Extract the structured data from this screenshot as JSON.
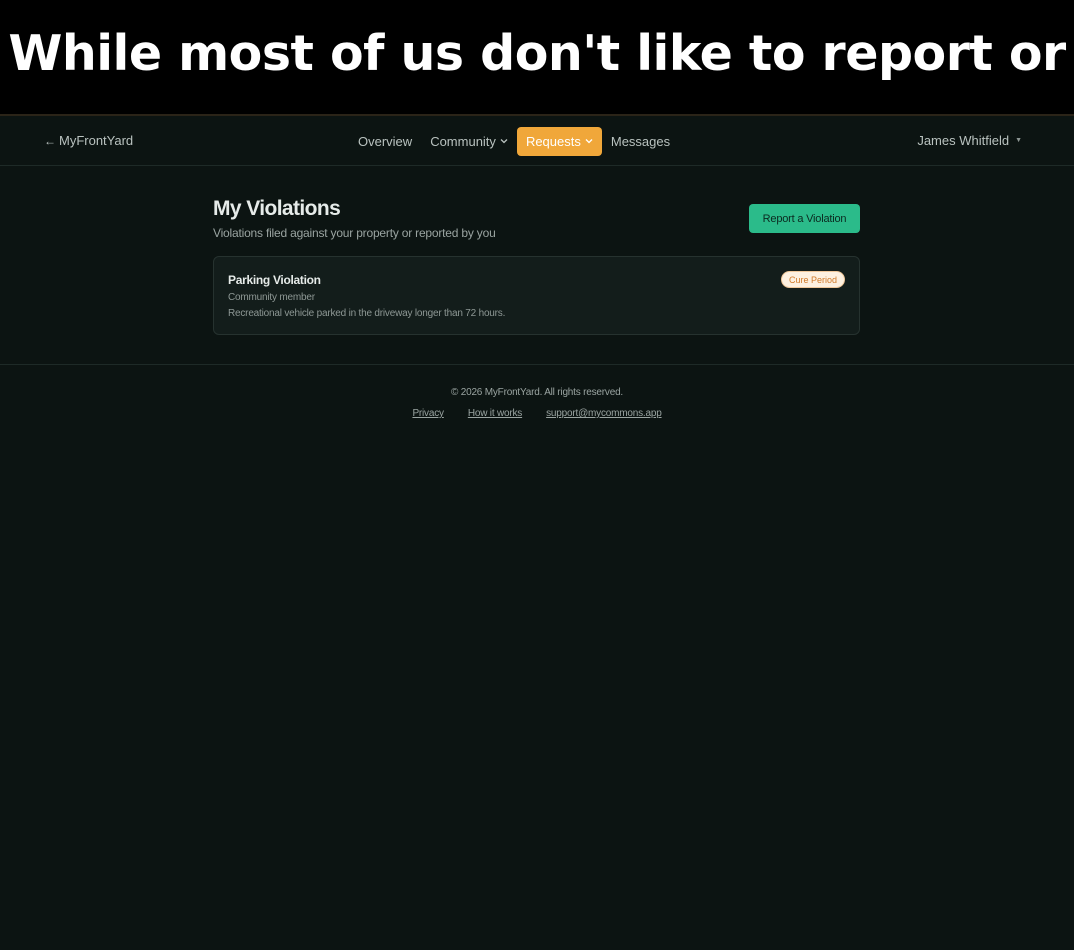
{
  "caption": "While most of us don't like to report or",
  "nav": {
    "back_label": "MyFrontYard",
    "items": [
      {
        "label": "Overview"
      },
      {
        "label": "Community"
      },
      {
        "label": "Requests"
      },
      {
        "label": "Messages"
      }
    ],
    "user_name": "James Whitfield"
  },
  "main": {
    "title": "My Violations",
    "subtitle": "Violations filed against your property or reported by you",
    "report_button": "Report a Violation",
    "violations": [
      {
        "title": "Parking Violation",
        "reporter": "Community member",
        "description": "Recreational vehicle parked in the driveway longer than 72 hours.",
        "status": "Cure Period"
      }
    ]
  },
  "footer": {
    "copyright": "© 2026 MyFrontYard. All rights reserved.",
    "links": [
      "Privacy",
      "How it works",
      "support@mycommons.app"
    ]
  },
  "colors": {
    "accent_orange": "#f0a73a",
    "accent_green": "#2bbb8a",
    "background": "#0c1412"
  }
}
